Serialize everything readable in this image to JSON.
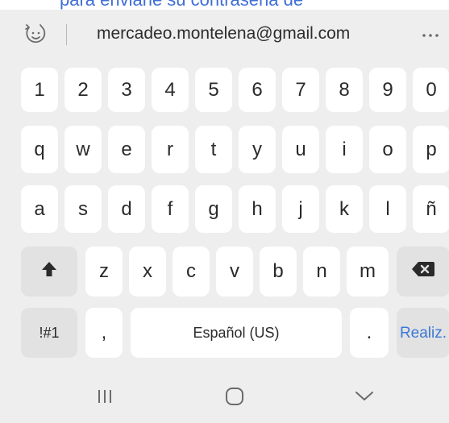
{
  "background_field": {
    "partial_text": "para enviarle su contraseña de"
  },
  "suggestion_bar": {
    "clipboard_icon": "clipboard-smile-icon",
    "suggestion": "mercadeo.montelena@gmail.com",
    "more_icon": "more-horizontal-icon"
  },
  "keyboard": {
    "number_row": [
      "1",
      "2",
      "3",
      "4",
      "5",
      "6",
      "7",
      "8",
      "9",
      "0"
    ],
    "row_q": [
      "q",
      "w",
      "e",
      "r",
      "t",
      "y",
      "u",
      "i",
      "o",
      "p"
    ],
    "row_a": [
      "a",
      "s",
      "d",
      "f",
      "g",
      "h",
      "j",
      "k",
      "l",
      "ñ"
    ],
    "row_z": [
      "z",
      "x",
      "c",
      "v",
      "b",
      "n",
      "m"
    ],
    "shift_icon": "shift-arrow-up-icon",
    "backspace_icon": "backspace-icon",
    "symbols_label": "!#1",
    "comma_label": ",",
    "space_label": "Español (US)",
    "period_label": ".",
    "done_label": "Realiz."
  },
  "navbar": {
    "recents_icon": "recent-apps-icon",
    "home_icon": "home-icon",
    "back_icon": "hide-keyboard-chevron-icon"
  },
  "colors": {
    "keyboard_bg": "#eeeeee",
    "key_bg": "#ffffff",
    "function_key_bg": "#e2e2e2",
    "accent": "#3b78d8"
  }
}
